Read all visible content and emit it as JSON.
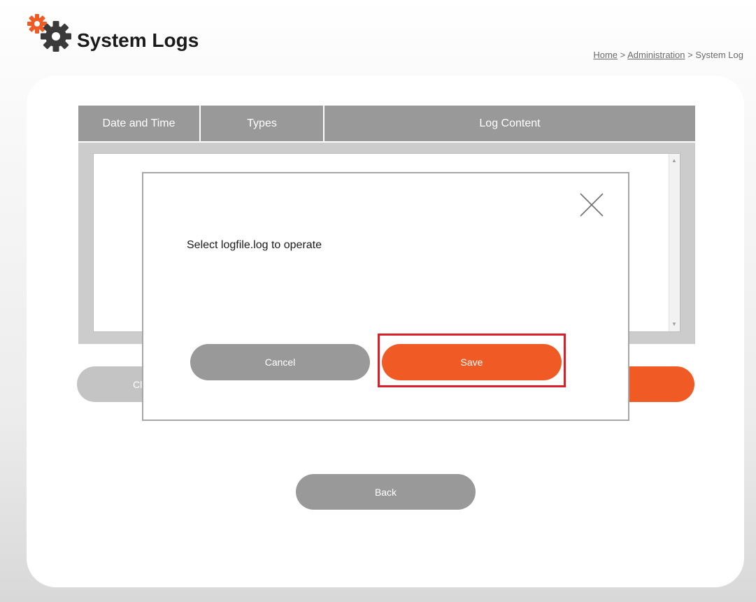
{
  "header": {
    "title": "System Logs",
    "icon": "gears-icon"
  },
  "breadcrumb": {
    "home": "Home",
    "separator1": " > ",
    "administration": "Administration",
    "separator2": " > ",
    "current": "System Log"
  },
  "log_table": {
    "columns": [
      "Date and Time",
      "Types",
      "Log Content"
    ],
    "content": ""
  },
  "background_buttons": {
    "clear_label": "Cl",
    "save_label": "",
    "back_label": "Back"
  },
  "modal": {
    "message": "Select logfile.log to operate",
    "cancel_label": "Cancel",
    "save_label": "Save",
    "close_icon": "close-icon"
  },
  "colors": {
    "accent": "#f05a24",
    "gray_button": "#999999",
    "highlight": "#d81f2a"
  }
}
